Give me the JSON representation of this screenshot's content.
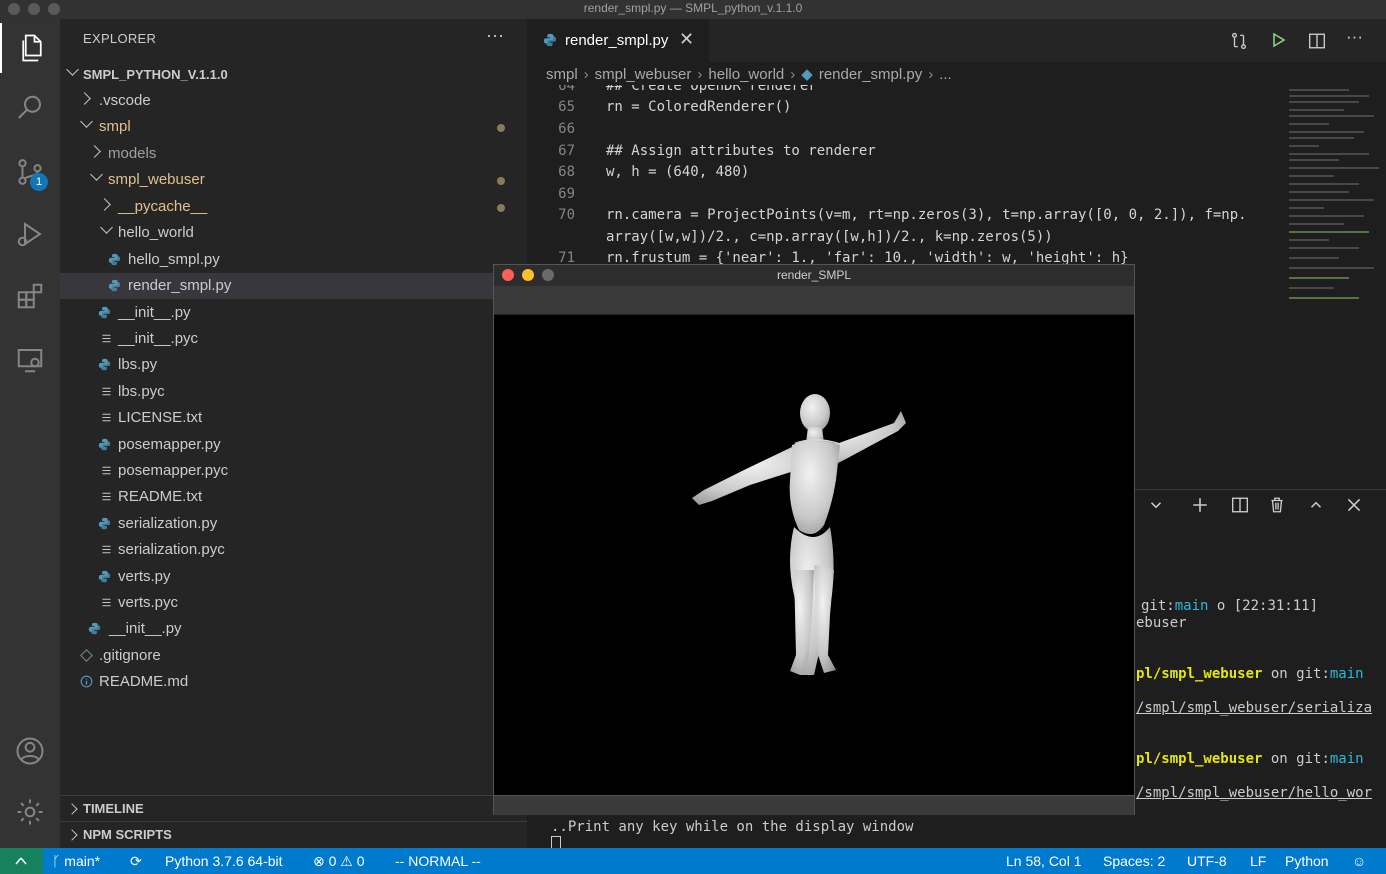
{
  "window": {
    "title": "render_smpl.py — SMPL_python_v.1.1.0"
  },
  "activity_bar": {
    "scm_badge": "1"
  },
  "explorer": {
    "header": "EXPLORER",
    "more": "···",
    "root": "SMPL_PYTHON_V.1.1.0",
    "items": [
      {
        "label": ".vscode"
      },
      {
        "label": "smpl"
      },
      {
        "label": "models"
      },
      {
        "label": "smpl_webuser"
      },
      {
        "label": "__pycache__"
      },
      {
        "label": "hello_world"
      },
      {
        "label": "hello_smpl.py"
      },
      {
        "label": "render_smpl.py"
      },
      {
        "label": "__init__.py"
      },
      {
        "label": "__init__.pyc"
      },
      {
        "label": "lbs.py"
      },
      {
        "label": "lbs.pyc"
      },
      {
        "label": "LICENSE.txt"
      },
      {
        "label": "posemapper.py"
      },
      {
        "label": "posemapper.pyc"
      },
      {
        "label": "README.txt"
      },
      {
        "label": "serialization.py"
      },
      {
        "label": "serialization.pyc"
      },
      {
        "label": "verts.py"
      },
      {
        "label": "verts.pyc"
      },
      {
        "label": "__init__.py"
      },
      {
        "label": ".gitignore"
      },
      {
        "label": "README.md"
      }
    ],
    "sections": {
      "timeline": "TIMELINE",
      "npm": "NPM SCRIPTS"
    }
  },
  "editor": {
    "tab": {
      "label": "render_smpl.py",
      "close": "✕"
    },
    "breadcrumb": [
      "smpl",
      "smpl_webuser",
      "hello_world",
      "render_smpl.py",
      "..."
    ],
    "lines": {
      "n64": "64",
      "n65": "65",
      "n66": "66",
      "n67": "67",
      "n68": "68",
      "n69": "69",
      "n70": "70",
      "n71": "71",
      "t64": "## Create OpenDR renderer",
      "t65": "rn = ColoredRenderer()",
      "t67": "## Assign attributes to renderer",
      "t68": "w, h = (640, 480)",
      "t70a": "rn.camera = ProjectPoints(v=m, rt=np.zeros(3), t=np.array([0, 0, 2.]), f=np.",
      "t70b": "array([w,w])/2., c=np.array([w,h])/2., k=np.zeros(5))",
      "t71": "rn.frustum = {'near': 1., 'far': 10., 'width': w, 'height': h}"
    }
  },
  "terminal": {
    "l1_pre": "git:",
    "l1_branch": "main",
    "l1_post": " o [22:31:11]",
    "l2": "ebuser",
    "l3_path": "pl/smpl_webuser",
    "l3_on": " on git:",
    "l3_branch": "main",
    "l4": "/smpl/smpl_webuser/serializa",
    "l5_path": "pl/smpl_webuser",
    "l5_on": " on git:",
    "l5_branch": "main",
    "l6": "/smpl/smpl_webuser/hello_wor",
    "l7": "..Print any key while on the display window"
  },
  "render_window": {
    "title": "render_SMPL"
  },
  "statusbar": {
    "branch": "main*",
    "python": "Python 3.7.6 64-bit",
    "errors": "0",
    "warnings": "0",
    "mode": "-- NORMAL --",
    "position": "Ln 58, Col 1",
    "spaces": "Spaces: 2",
    "encoding": "UTF-8",
    "eol": "LF",
    "language": "Python"
  }
}
